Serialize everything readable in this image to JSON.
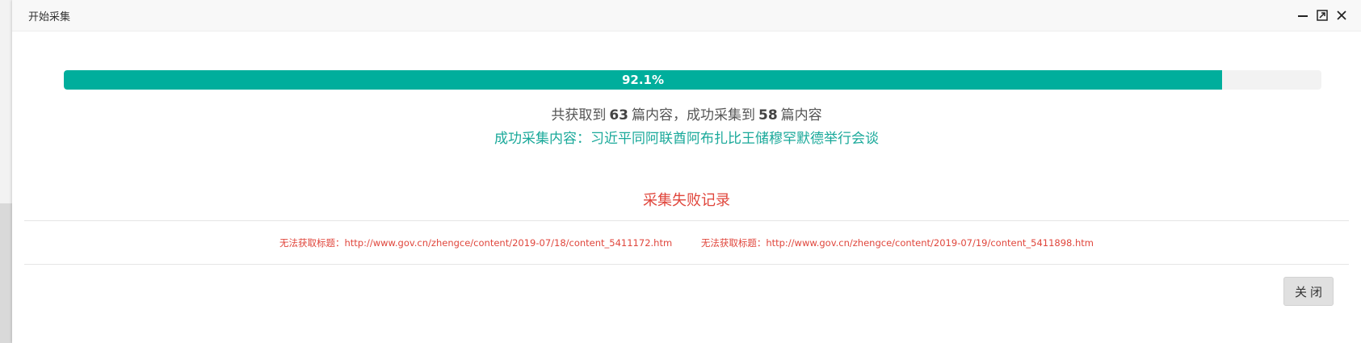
{
  "window": {
    "title": "开始采集"
  },
  "progress": {
    "percent": 92.1,
    "label": "92.1%",
    "fill_color": "#00ae9c"
  },
  "summary": {
    "prefix": "共获取到",
    "total": "63",
    "middle": "篇内容，成功采集到",
    "success": "58",
    "suffix": "篇内容"
  },
  "success_line": "成功采集内容：习近平同阿联酋阿布扎比王储穆罕默德举行会谈",
  "fail_section": {
    "title": "采集失败记录",
    "items": [
      "无法获取标题：http://www.gov.cn/zhengce/content/2019-07/18/content_5411172.htm",
      "无法获取标题：http://www.gov.cn/zhengce/content/2019-07/19/content_5411898.htm"
    ]
  },
  "buttons": {
    "close_label": "关闭"
  },
  "icons": {
    "minimize": "minimize-icon",
    "maximize": "maximize-icon",
    "close": "close-icon"
  }
}
